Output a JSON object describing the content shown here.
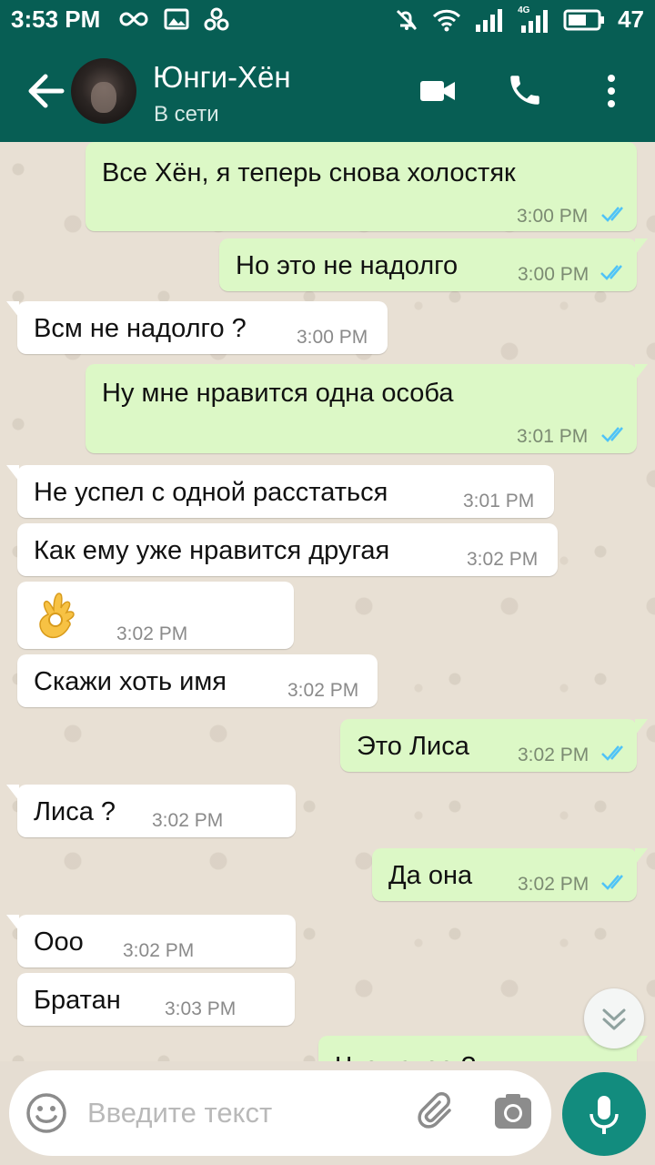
{
  "status_bar": {
    "time": "3:53 PM",
    "battery_level": "47",
    "network_label": "4G"
  },
  "header": {
    "contact_name": "Юнги-Хён",
    "contact_status": "В сети"
  },
  "messages": [
    {
      "direction": "out",
      "text": "Все Хён, я теперь снова холостяк",
      "time": "3:00 PM",
      "read": true
    },
    {
      "direction": "out",
      "text": "Но это не надолго",
      "time": "3:00 PM",
      "read": true
    },
    {
      "direction": "in",
      "text": "Всм не надолго ?",
      "time": "3:00 PM"
    },
    {
      "direction": "out",
      "text": "Ну мне нравится одна особа",
      "time": "3:01 PM",
      "read": true
    },
    {
      "direction": "in",
      "text": "Не успел с одной расстаться",
      "time": "3:01 PM"
    },
    {
      "direction": "in",
      "text": "Как ему уже нравится другая",
      "time": "3:02 PM"
    },
    {
      "direction": "in",
      "emoji": "ok-hand-emoji",
      "time": "3:02 PM"
    },
    {
      "direction": "in",
      "text": "Скажи хоть имя",
      "time": "3:02 PM"
    },
    {
      "direction": "out",
      "text": "Это Лиса",
      "time": "3:02 PM",
      "read": true
    },
    {
      "direction": "in",
      "text": "Лиса ?",
      "time": "3:02 PM"
    },
    {
      "direction": "out",
      "text": "Да она",
      "time": "3:02 PM",
      "read": true
    },
    {
      "direction": "in",
      "text": "Ооо",
      "time": "3:02 PM"
    },
    {
      "direction": "in",
      "text": "Братан",
      "time": "3:03 PM"
    },
    {
      "direction": "out",
      "text": "Что такое ?",
      "partial": true
    }
  ],
  "composer": {
    "placeholder": "Введите текст"
  },
  "colors": {
    "header": "#075e54",
    "outgoing_bubble": "#dcf8c6",
    "incoming_bubble": "#ffffff",
    "read_ticks": "#4fc3f7",
    "mic_button": "#128c7e"
  },
  "icons": [
    "back-arrow-icon",
    "video-call-icon",
    "phone-icon",
    "more-vert-icon",
    "emoji-icon",
    "attach-icon",
    "camera-icon",
    "mic-icon",
    "chevron-down-icon"
  ]
}
